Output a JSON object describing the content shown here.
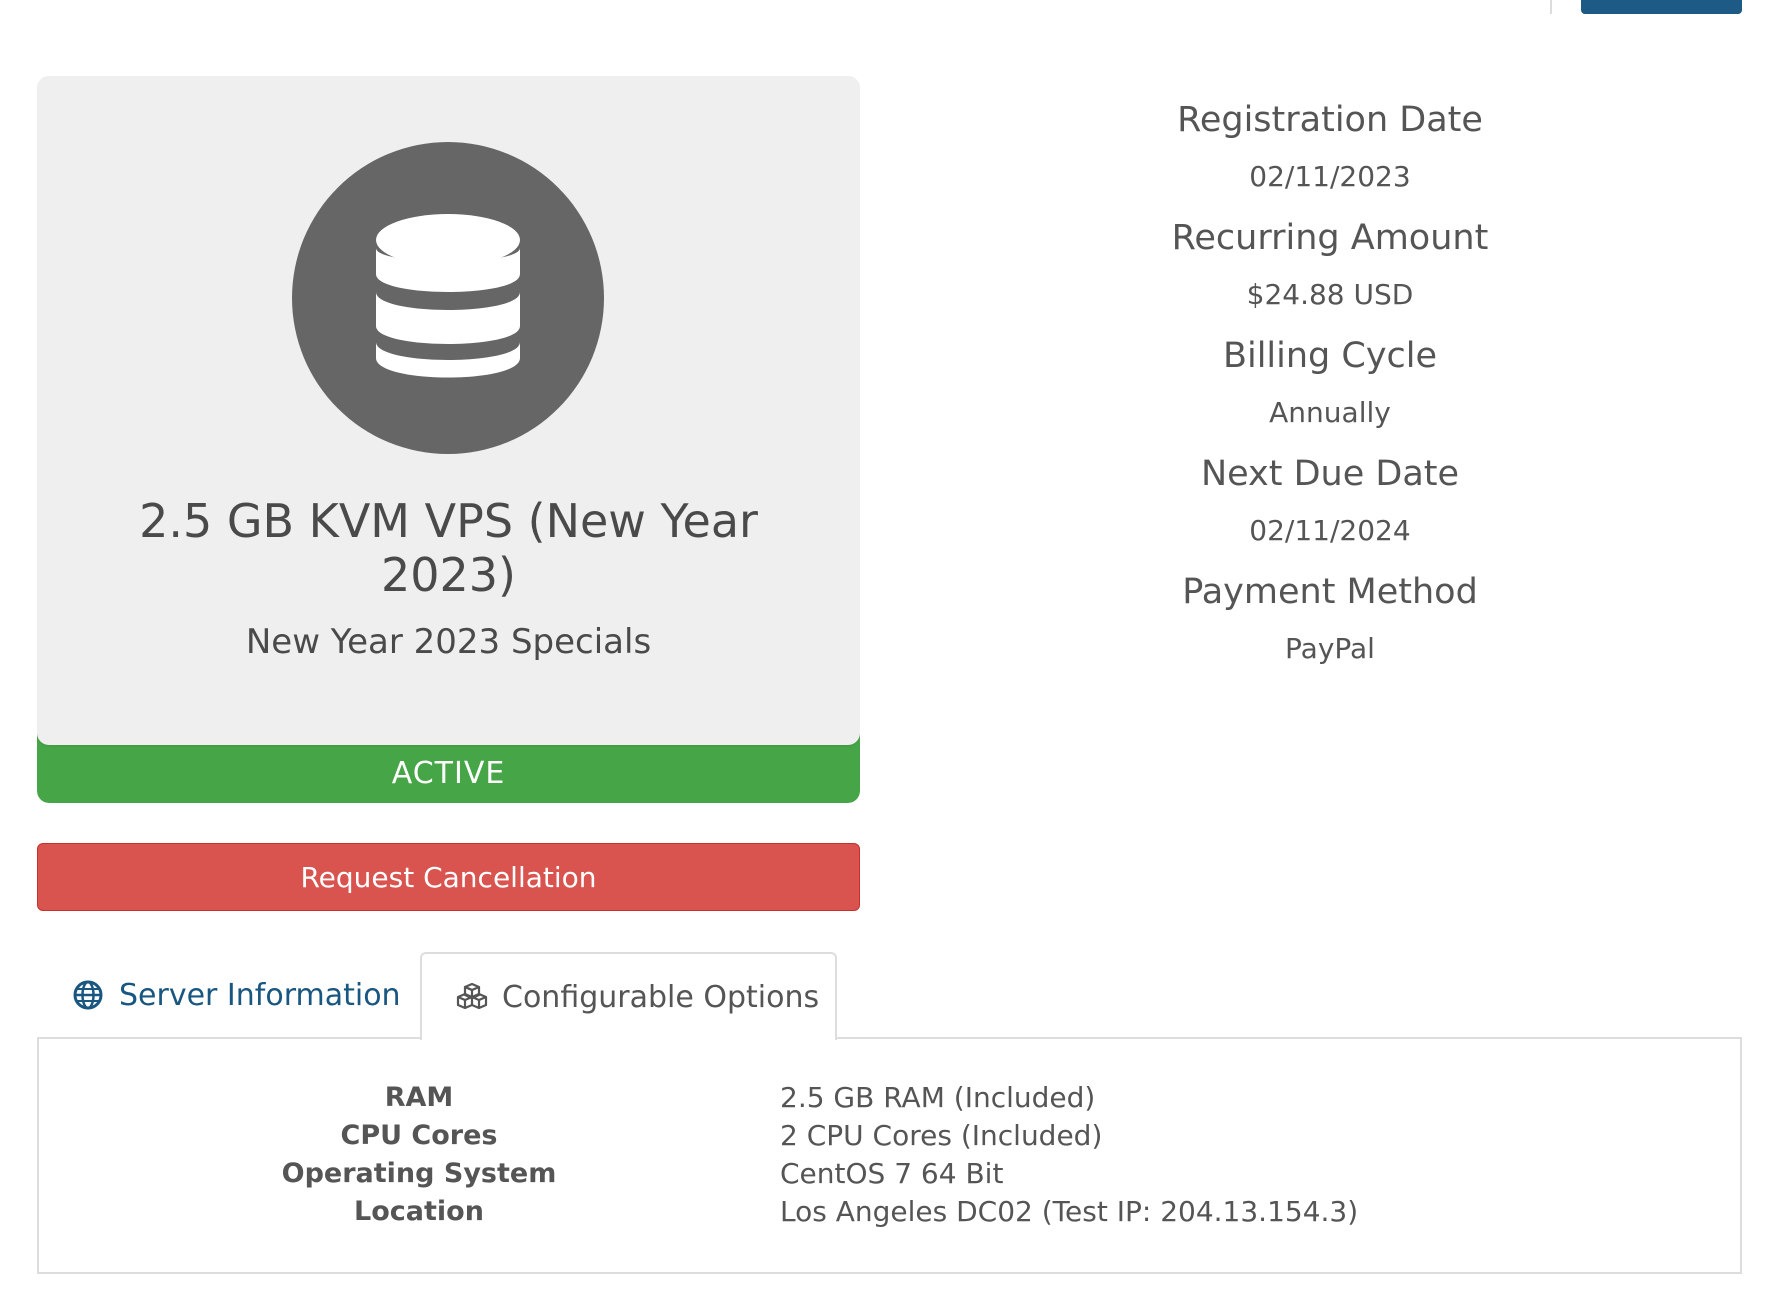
{
  "product": {
    "icon": "database-icon",
    "name": "2.5 GB KVM VPS (New Year 2023)",
    "group": "New Year 2023 Specials",
    "status": "ACTIVE",
    "status_color": "#46a546"
  },
  "actions": {
    "cancel_label": "Request Cancellation",
    "cancel_color": "#d9534f"
  },
  "billing": {
    "registration_date_label": "Registration Date",
    "registration_date": "02/11/2023",
    "recurring_amount_label": "Recurring Amount",
    "recurring_amount": "$24.88 USD",
    "billing_cycle_label": "Billing Cycle",
    "billing_cycle": "Annually",
    "next_due_date_label": "Next Due Date",
    "next_due_date": "02/11/2024",
    "payment_method_label": "Payment Method",
    "payment_method": "PayPal"
  },
  "tabs": [
    {
      "label": "Server Information",
      "icon": "globe-icon",
      "active": false
    },
    {
      "label": "Configurable Options",
      "icon": "cubes-icon",
      "active": true
    }
  ],
  "configurable_options": [
    {
      "label": "RAM",
      "value": "2.5 GB RAM (Included)"
    },
    {
      "label": "CPU Cores",
      "value": "2 CPU Cores (Included)"
    },
    {
      "label": "Operating System",
      "value": "CentOS 7 64 Bit"
    },
    {
      "label": "Location",
      "value": "Los Angeles DC02 (Test IP: 204.13.154.3)"
    }
  ],
  "colors": {
    "link_blue": "#195680",
    "primary_button": "#1d5a85"
  }
}
